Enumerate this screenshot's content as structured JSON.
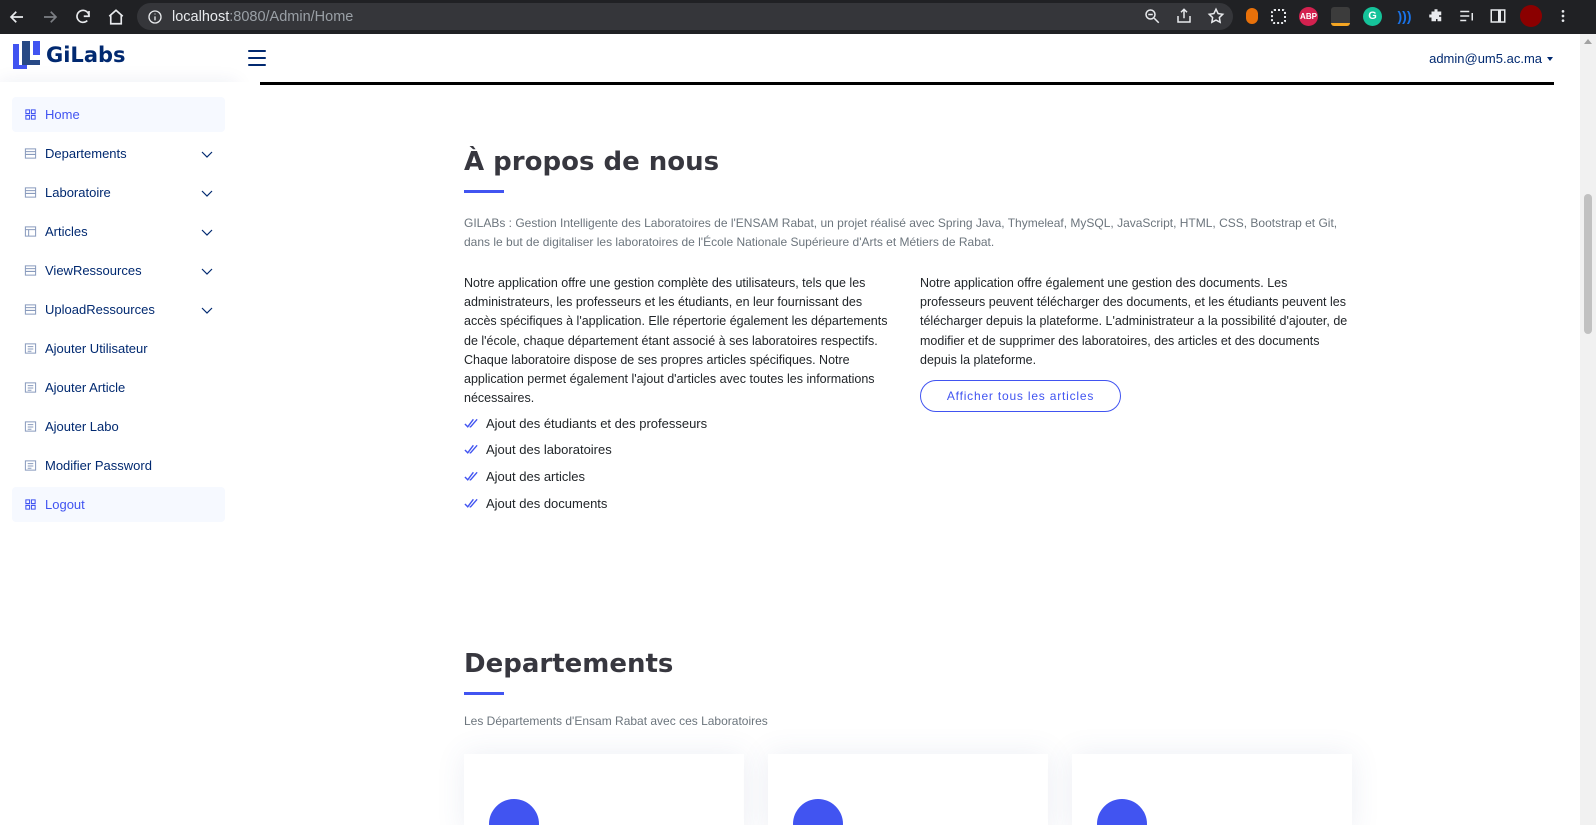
{
  "browser": {
    "url_host": "localhost",
    "url_path": ":8080/Admin/Home",
    "extensions": [
      {
        "name": "fox-extension-icon",
        "color": "#e8710a",
        "label": ""
      },
      {
        "name": "grid-extension-icon",
        "color": "#5f6368",
        "label": ""
      },
      {
        "name": "adblock-extension-icon",
        "color": "#d3214f",
        "label": "ABP"
      },
      {
        "name": "dark-extension-icon",
        "color": "#3c3c3c",
        "label": ""
      },
      {
        "name": "grammarly-extension-icon",
        "color": "#15c39a",
        "label": "G"
      },
      {
        "name": "voice-extension-icon",
        "color": "#1a73e8",
        "label": ""
      },
      {
        "name": "puzzle-extensions-icon",
        "color": "#e8eaed",
        "label": ""
      }
    ]
  },
  "header": {
    "logo_text": "GiLabs",
    "user_email": "admin@um5.ac.ma"
  },
  "sidebar": {
    "items": [
      {
        "label": "Home",
        "icon": "grid-icon",
        "active": true,
        "has_children": false
      },
      {
        "label": "Departements",
        "icon": "table-icon",
        "active": false,
        "has_children": true
      },
      {
        "label": "Laboratoire",
        "icon": "table-icon",
        "active": false,
        "has_children": true
      },
      {
        "label": "Articles",
        "icon": "layout-icon",
        "active": false,
        "has_children": true
      },
      {
        "label": "ViewRessources",
        "icon": "table-icon",
        "active": false,
        "has_children": true
      },
      {
        "label": "UploadRessources",
        "icon": "table-icon",
        "active": false,
        "has_children": true
      },
      {
        "label": "Ajouter Utilisateur",
        "icon": "list-icon",
        "active": false,
        "has_children": false
      },
      {
        "label": "Ajouter Article",
        "icon": "list-icon",
        "active": false,
        "has_children": false
      },
      {
        "label": "Ajouter Labo",
        "icon": "list-icon",
        "active": false,
        "has_children": false
      },
      {
        "label": "Modifier Password",
        "icon": "list-icon",
        "active": false,
        "has_children": false
      },
      {
        "label": "Logout",
        "icon": "grid-icon",
        "active": true,
        "has_children": false
      }
    ]
  },
  "about": {
    "title": "À propos de nous",
    "intro": "GILABs : Gestion Intelligente des Laboratoires de l'ENSAM Rabat, un projet réalisé avec Spring Java, Thymeleaf, MySQL, JavaScript, HTML, CSS, Bootstrap et Git, dans le but de digitaliser les laboratoires de l'École Nationale Supérieure d'Arts et Métiers de Rabat.",
    "left_paragraph": "Notre application offre une gestion complète des utilisateurs, tels que les administrateurs, les professeurs et les étudiants, en leur fournissant des accès spécifiques à l'application. Elle répertorie également les départements de l'école, chaque département étant associé à ses laboratoires respectifs. Chaque laboratoire dispose de ses propres articles spécifiques. Notre application permet également l'ajout d'articles avec toutes les informations nécessaires.",
    "right_paragraph": "Notre application offre également une gestion des documents. Les professeurs peuvent télécharger des documents, et les étudiants peuvent les télécharger depuis la plateforme. L'administrateur a la possibilité d'ajouter, de modifier et de supprimer des laboratoires, des articles et des documents depuis la plateforme.",
    "features": [
      "Ajout des étudiants et des professeurs",
      "Ajout des laboratoires",
      "Ajout des articles",
      "Ajout des documents"
    ],
    "button_label": "Afficher tous les articles"
  },
  "departements": {
    "title": "Departements",
    "subtitle": "Les Départements d'Ensam Rabat avec ces Laboratoires"
  },
  "colors": {
    "accent": "#4154f1",
    "navy": "#012970"
  }
}
